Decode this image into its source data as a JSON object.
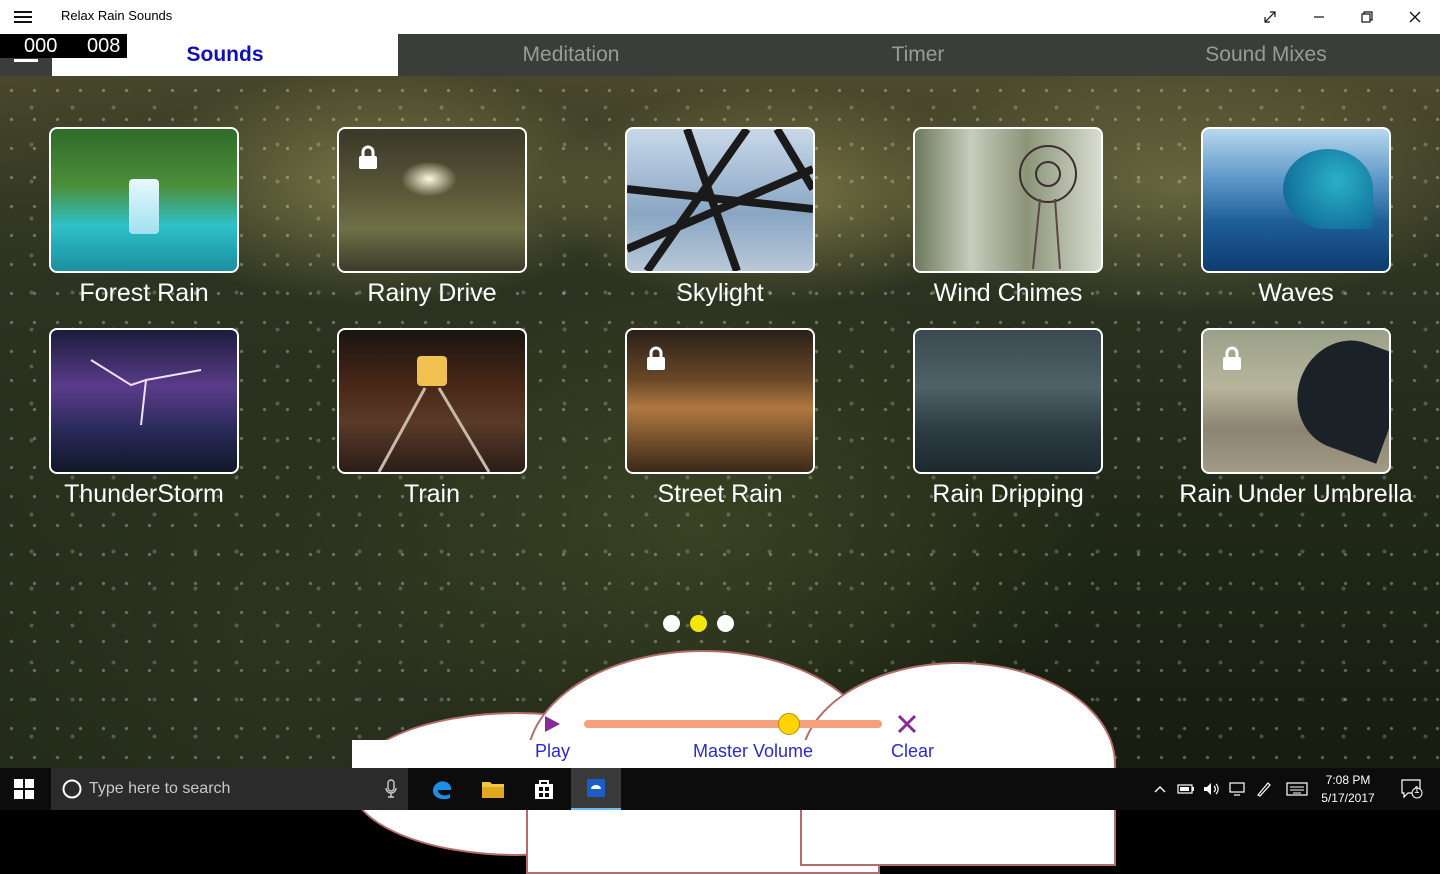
{
  "window": {
    "title": "Relax Rain Sounds"
  },
  "counter": {
    "left": "000",
    "right": "008"
  },
  "tabs": [
    {
      "label": "Sounds",
      "active": true
    },
    {
      "label": "Meditation"
    },
    {
      "label": "Timer"
    },
    {
      "label": "Sound Mixes"
    }
  ],
  "sounds": [
    {
      "label": "Forest Rain",
      "locked": false
    },
    {
      "label": "Rainy Drive",
      "locked": true
    },
    {
      "label": "Skylight",
      "locked": false
    },
    {
      "label": "Wind Chimes",
      "locked": false
    },
    {
      "label": "Waves",
      "locked": false
    },
    {
      "label": "ThunderStorm",
      "locked": false
    },
    {
      "label": "Train",
      "locked": false
    },
    {
      "label": "Street Rain",
      "locked": true
    },
    {
      "label": "Rain Dripping",
      "locked": false
    },
    {
      "label": "Rain Under Umbrella",
      "locked": true
    }
  ],
  "pager": {
    "pages": 3,
    "active_page": 2
  },
  "controls": {
    "play_label": "Play",
    "volume_label": "Master Volume",
    "clear_label": "Clear",
    "master_volume": 0.69
  },
  "taskbar": {
    "search_placeholder": "Type here to search",
    "time": "7:08 PM",
    "date": "5/17/2017",
    "notifications": "1"
  },
  "colors": {
    "accent": "#1010b8",
    "tab_bar": "#3b3d3b",
    "active_dot": "#f5e60a",
    "slider": "#f5a07a",
    "control_text": "#2a2ad0"
  }
}
